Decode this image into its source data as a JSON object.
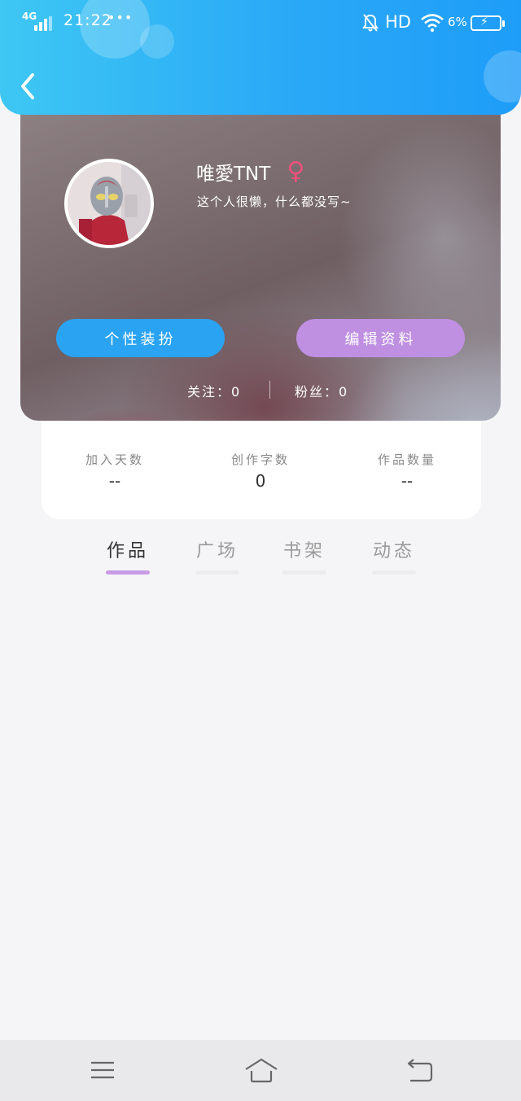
{
  "status_bar": {
    "network": "4G",
    "time": "21:22",
    "dots": "•••",
    "hd": "HD",
    "battery": "6%"
  },
  "profile": {
    "username": "唯愛TNT",
    "gender_symbol": "♀",
    "bio": "这个人很懒，什么都没写~",
    "dress_button": "个性装扮",
    "edit_button": "编辑资料",
    "following": "关注：0",
    "fans": "粉丝：0"
  },
  "stats": {
    "join_days_label": "加入天数",
    "join_days_value": "--",
    "words_label": "创作字数",
    "words_value": "0",
    "works_label": "作品数量",
    "works_value": "--"
  },
  "tabs": [
    {
      "label": "作品",
      "active": true
    },
    {
      "label": "广场",
      "active": false
    },
    {
      "label": "书架",
      "active": false
    },
    {
      "label": "动态",
      "active": false
    }
  ],
  "colors": {
    "header_blue": "#2aa9f7",
    "dress_button": "#2aa3f2",
    "edit_button": "#bf8fe2",
    "tab_active_underline": "#c99be6",
    "gender": "#f0507a"
  },
  "icons": [
    "back-chevron-icon",
    "mute-icon",
    "wifi-icon",
    "battery-icon",
    "menu-icon",
    "home-icon",
    "return-icon"
  ]
}
